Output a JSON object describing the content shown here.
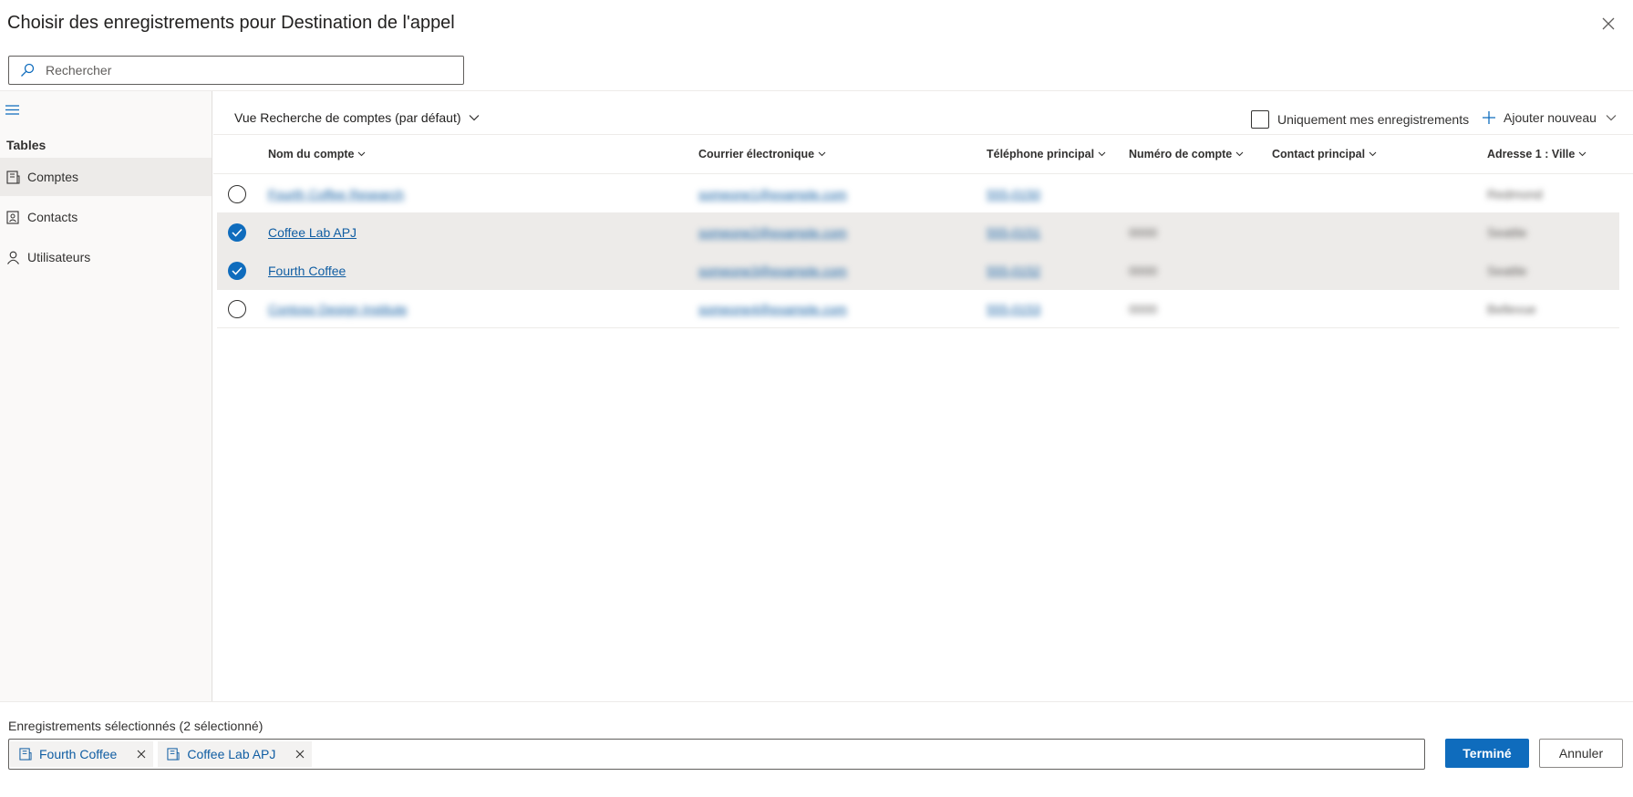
{
  "dialog": {
    "title": "Choisir des enregistrements pour Destination de l'appel"
  },
  "search": {
    "placeholder": "Rechercher",
    "value": ""
  },
  "sidebar": {
    "heading": "Tables",
    "items": [
      {
        "label": "Comptes",
        "icon": "account-icon",
        "active": true
      },
      {
        "label": "Contacts",
        "icon": "contact-card-icon",
        "active": false
      },
      {
        "label": "Utilisateurs",
        "icon": "person-icon",
        "active": false
      }
    ]
  },
  "toolbar": {
    "view_label": "Vue Recherche de comptes (par défaut)",
    "only_mine_label": "Uniquement mes enregistrements",
    "only_mine_checked": false,
    "add_new_label": "Ajouter nouveau"
  },
  "grid": {
    "columns": [
      "Nom du compte",
      "Courrier électronique",
      "Téléphone principal",
      "Numéro de compte",
      "Contact principal",
      "Adresse 1 : Ville"
    ],
    "rows": [
      {
        "selected": false,
        "name": "Fourth Coffee Research",
        "email": "someone1@example.com",
        "phone": "555-0150",
        "account_number": "",
        "contact": "",
        "city": "Redmond"
      },
      {
        "selected": true,
        "name": "Coffee Lab APJ",
        "email": "someone2@example.com",
        "phone": "555-0151",
        "account_number": "0000",
        "contact": "",
        "city": "Seattle"
      },
      {
        "selected": true,
        "name": "Fourth Coffee",
        "email": "someone3@example.com",
        "phone": "555-0152",
        "account_number": "0000",
        "contact": "",
        "city": "Seattle"
      },
      {
        "selected": false,
        "name": "Contoso Design Institute",
        "email": "someone4@example.com",
        "phone": "555-0153",
        "account_number": "0000",
        "contact": "",
        "city": "Bellevue"
      }
    ]
  },
  "footer": {
    "selected_label": "Enregistrements sélectionnés (2 sélectionné)",
    "chips": [
      {
        "label": "Fourth Coffee"
      },
      {
        "label": "Coffee Lab APJ"
      }
    ],
    "done_label": "Terminé",
    "cancel_label": "Annuler"
  },
  "colors": {
    "accent": "#0f6cbd",
    "link": "#115ea3",
    "selected_row": "#edebe9",
    "sidebar_bg": "#faf9f8"
  }
}
